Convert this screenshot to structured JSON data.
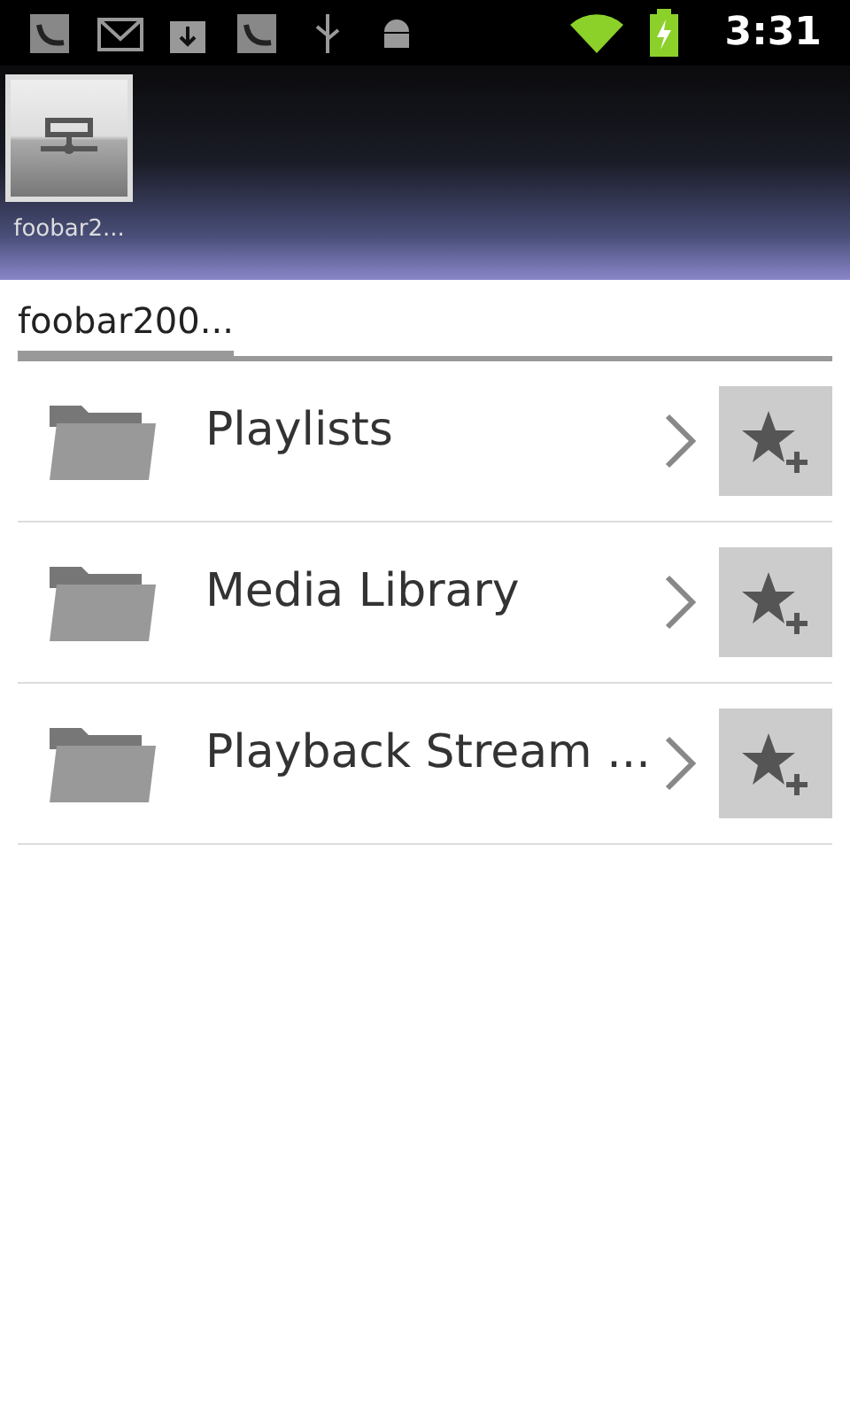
{
  "status_bar": {
    "time": "3:31"
  },
  "shortcuts": [
    {
      "label": "foobar2..."
    }
  ],
  "breadcrumb": [
    {
      "label": "foobar200...",
      "selected": true
    }
  ],
  "items": [
    {
      "label": "Playlists"
    },
    {
      "label": "Media Library"
    },
    {
      "label": "Playback Stream ..."
    }
  ]
}
